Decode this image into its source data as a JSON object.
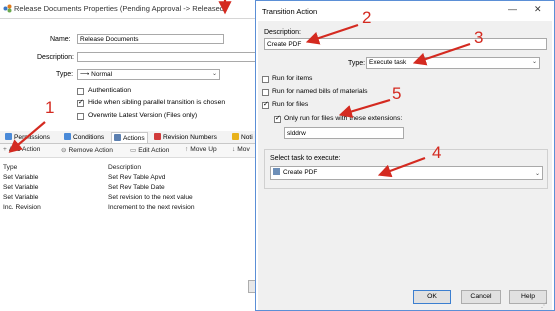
{
  "back": {
    "title": "Release Documents Properties (Pending Approval -> Released)",
    "name_label": "Name:",
    "name_value": "Release Documents",
    "description_label": "Description:",
    "description_value": "",
    "type_label": "Type:",
    "type_value": "Normal",
    "checkboxes": [
      {
        "label": "Authentication",
        "checked": false
      },
      {
        "label": "Hide when sibling parallel transition is chosen",
        "checked": true
      },
      {
        "label": "Overwrite Latest Version (Files only)",
        "checked": false
      }
    ],
    "tabs": [
      "Permissions",
      "Conditions",
      "Actions",
      "Revision Numbers",
      "Noti"
    ],
    "toolbar": [
      "Add Action",
      "Remove Action",
      "Edit Action",
      "Move Up",
      "Mov"
    ],
    "columns": [
      "Type",
      "Description"
    ],
    "rows": [
      [
        "Set Variable",
        "Set Rev Table Apvd"
      ],
      [
        "Set Variable",
        "Set Rev Table Date"
      ],
      [
        "Set Variable",
        "Set revision to the next value"
      ],
      [
        "Inc. Revision",
        "Increment to the next revision"
      ]
    ]
  },
  "dialog": {
    "title": "Transition Action",
    "description_label": "Description:",
    "description_value": "Create PDF",
    "type_label": "Type:",
    "type_value": "Execute task",
    "checkboxes": [
      {
        "label": "Run for items",
        "checked": false
      },
      {
        "label": "Run for named bills of materials",
        "checked": false
      },
      {
        "label": "Run for files",
        "checked": true
      }
    ],
    "extensions_checkbox": {
      "label": "Only run for files with these extensions:",
      "checked": true
    },
    "extensions_value": "slddrw",
    "task_label": "Select task to execute:",
    "task_value": "Create PDF",
    "buttons": {
      "ok": "OK",
      "cancel": "Cancel",
      "help": "Help"
    }
  },
  "annotations": [
    "1",
    "2",
    "3",
    "4",
    "5"
  ],
  "colors": {
    "annotation": "#d42a20",
    "dialog_border": "#5b8fd6"
  }
}
